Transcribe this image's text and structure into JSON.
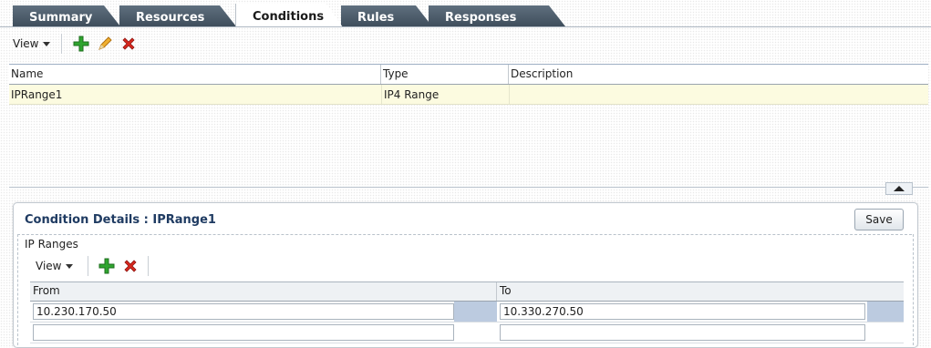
{
  "tabs": [
    {
      "label": "Summary",
      "active": false
    },
    {
      "label": "Resources",
      "active": false
    },
    {
      "label": "Conditions",
      "active": true
    },
    {
      "label": "Rules",
      "active": false
    },
    {
      "label": "Responses",
      "active": false
    }
  ],
  "toolbar": {
    "view_label": "View",
    "icons": [
      "add-icon",
      "edit-icon",
      "delete-icon"
    ]
  },
  "conditions_table": {
    "columns": [
      "Name",
      "Type",
      "Description"
    ],
    "rows": [
      {
        "name": "IPRange1",
        "type": "IP4 Range",
        "description": ""
      }
    ]
  },
  "details": {
    "title": "Condition Details : IPRange1",
    "save_label": "Save",
    "section_label": "IP Ranges",
    "view_label": "View",
    "columns": [
      "From",
      "To"
    ],
    "rows": [
      {
        "from": "10.230.170.50",
        "to": "10.330.270.50"
      },
      {
        "from": "",
        "to": ""
      }
    ]
  },
  "colors": {
    "tab_inactive": "#4d5d6c",
    "row_highlight": "#fcfbe0",
    "title_text": "#1f3b62",
    "add_icon": "#2fa52f",
    "delete_icon": "#d8281e",
    "edit_icon": "#e0a020"
  }
}
